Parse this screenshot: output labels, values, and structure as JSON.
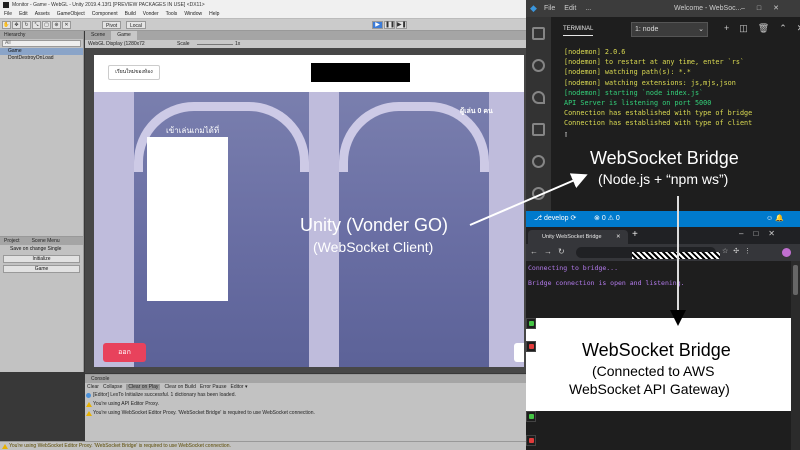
{
  "unity": {
    "title": "Monitor - Game - WebGL - Unity 2019.4.13f1 [PREVIEW PACKAGES IN USE] <DX11>",
    "menu": [
      "File",
      "Edit",
      "Assets",
      "GameObject",
      "Component",
      "Build",
      "Vonder",
      "Tools",
      "Window",
      "Help"
    ],
    "toolbar": {
      "pivot": "Pivot",
      "local": "Local",
      "play": "▶",
      "pause": "❚❚",
      "step": "▶❚"
    },
    "hierarchy": {
      "tab": "Hierarchy",
      "search": "All",
      "rows": [
        "Game",
        "DontDestroyOnLoad"
      ]
    },
    "project": {
      "tabs": [
        "Project",
        "Scene Menu"
      ],
      "save_label": "Save on change",
      "save_value": "Single",
      "buttons": [
        "Initialize",
        "Game"
      ]
    },
    "game": {
      "tabs": [
        "Scene",
        "Game"
      ],
      "display": "WebGL Display (1280x72",
      "scale_label": "Scale",
      "scale_value": "1x",
      "refresh": "เรียนใหม่ของห้อง",
      "players": "ผู้เล่น 0 คน",
      "join": "เข้าเล่นเกมได้ที่",
      "exit": "ออก"
    },
    "console": {
      "tab": "Console",
      "buttons": [
        "Clear",
        "Collapse",
        "Clear on Play",
        "Clear on Build",
        "Error Pause",
        "Editor ▾"
      ],
      "rows": [
        "[Editor] LexTo Initialize successful. 1 dictionary has been loaded.",
        "You're using API Editor Proxy.",
        "You're using WebSocket Editor Proxy. 'WebSocket Bridge' is required to use WebSocket connection."
      ]
    },
    "status": "You're using WebSocket Editor Proxy. 'WebSocket Bridge' is required to use WebSocket connection."
  },
  "vscode": {
    "menu": [
      "File",
      "Edit",
      "..."
    ],
    "window_title": "Welcome - WebSoc...",
    "terminal_tab": "TERMINAL",
    "terminal_select": "1: node",
    "terminal_lines": [
      {
        "text": "[nodemon] 2.0.6",
        "color": "ty"
      },
      {
        "text": "[nodemon] to restart at any time, enter `rs`",
        "color": "ty"
      },
      {
        "text": "[nodemon] watching path(s): *.*",
        "color": "ty"
      },
      {
        "text": "[nodemon] watching extensions: js,mjs,json",
        "color": "ty"
      },
      {
        "text": "[nodemon] starting `node index.js`",
        "color": "tg"
      },
      {
        "text": "API Server is listening on port 5000",
        "color": "tg"
      },
      {
        "text": "Connection has established with type of bridge",
        "color": "ty"
      },
      {
        "text": "Connection has established with type of client",
        "color": "ty"
      }
    ],
    "branch": "develop",
    "errors": "0",
    "warnings": "0"
  },
  "chrome": {
    "tab_title": "Unity WebSocket Bridge",
    "log": [
      "Connecting to bridge...",
      "Bridge connection is open and listening."
    ]
  },
  "annotations": {
    "unity_title": "Unity (Vonder GO)",
    "unity_sub": "(WebSocket Client)",
    "bridge_title": "WebSocket Bridge",
    "bridge_sub": "(Node.js + “npm ws”)",
    "gateway_title": "WebSocket Bridge",
    "gateway_sub1": "(Connected to AWS",
    "gateway_sub2": "WebSocket API Gateway)"
  }
}
